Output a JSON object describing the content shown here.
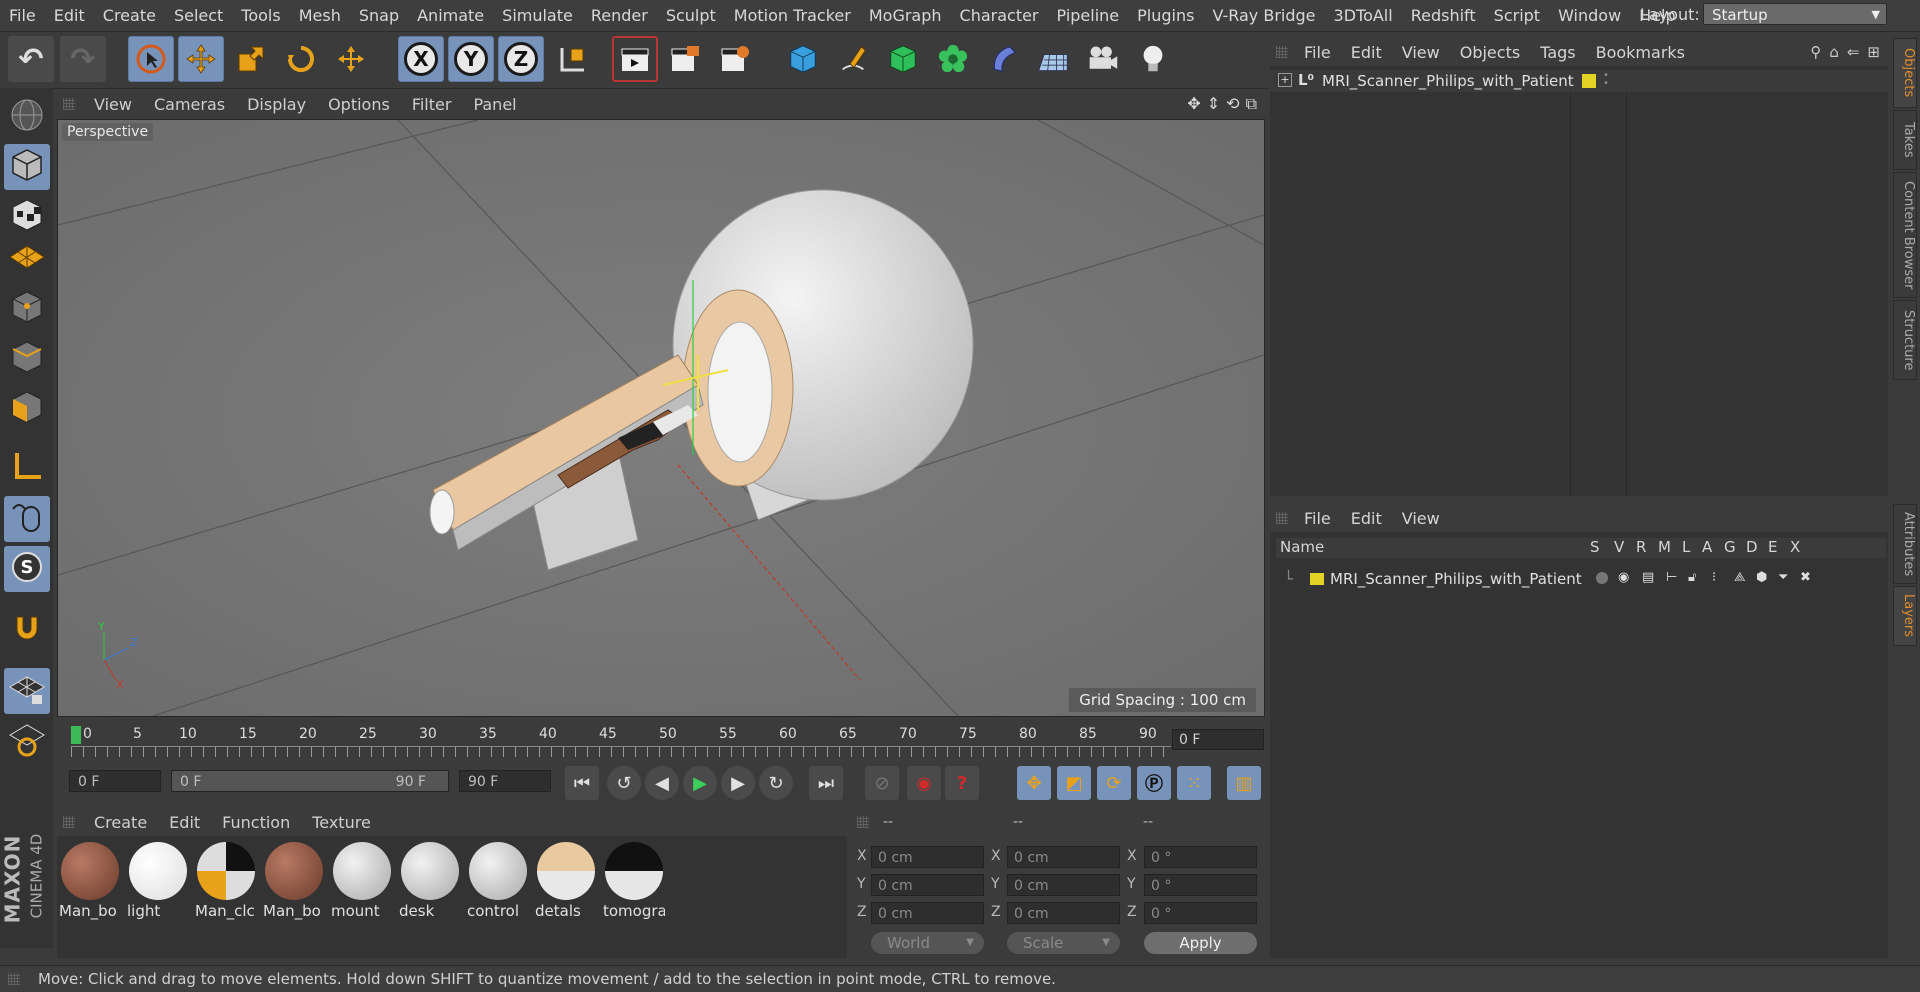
{
  "menubar": {
    "items": [
      "File",
      "Edit",
      "Create",
      "Select",
      "Tools",
      "Mesh",
      "Snap",
      "Animate",
      "Simulate",
      "Render",
      "Sculpt",
      "Motion Tracker",
      "MoGraph",
      "Character",
      "Pipeline",
      "Plugins",
      "V-Ray Bridge",
      "3DToAll",
      "Redshift",
      "Script",
      "Window",
      "Help"
    ],
    "layout_label": "Layout:",
    "layout_value": "Startup"
  },
  "toolbar": {
    "axis_x": "X",
    "axis_y": "Y",
    "axis_z": "Z"
  },
  "viewport": {
    "menu": [
      "View",
      "Cameras",
      "Display",
      "Options",
      "Filter",
      "Panel"
    ],
    "label": "Perspective",
    "grid_spacing": "Grid Spacing : 100 cm",
    "axis_x": "X",
    "axis_y": "Y",
    "axis_z": "Z"
  },
  "timeline": {
    "ticks": [
      "0",
      "5",
      "10",
      "15",
      "20",
      "25",
      "30",
      "35",
      "40",
      "45",
      "50",
      "55",
      "60",
      "65",
      "70",
      "75",
      "80",
      "85",
      "90"
    ],
    "current_frame": "0 F"
  },
  "transport": {
    "start_field": "0 F",
    "range_start": "0 F",
    "range_end": "90 F",
    "end_field": "90 F"
  },
  "materials": {
    "menu": [
      "Create",
      "Edit",
      "Function",
      "Texture"
    ],
    "items": [
      {
        "label": "Man_bo",
        "color": "#8a4a3a"
      },
      {
        "label": "light",
        "color": "#ffffff"
      },
      {
        "label": "Man_clc",
        "color": "#1c1c1c"
      },
      {
        "label": "Man_bo",
        "color": "#8a4a3a"
      },
      {
        "label": "mount",
        "color": "#d9d9d9"
      },
      {
        "label": "desk",
        "color": "#d9d9d9"
      },
      {
        "label": "control",
        "color": "#d9d9d9"
      },
      {
        "label": "detals",
        "color": "#e8c9a0"
      },
      {
        "label": "tomogra",
        "color": "#e6e6e6"
      }
    ]
  },
  "coords": {
    "headers": [
      "--",
      "--",
      "--"
    ],
    "rows": [
      {
        "axis": "X",
        "pos": "0 cm",
        "size": "0 cm",
        "rot": "0 °"
      },
      {
        "axis": "Y",
        "pos": "0 cm",
        "size": "0 cm",
        "rot": "0 °"
      },
      {
        "axis": "Z",
        "pos": "0 cm",
        "size": "0 cm",
        "rot": "0 °"
      }
    ],
    "size_labels": [
      "X",
      "Y",
      "Z"
    ],
    "rot_labels": [
      "X",
      "Y",
      "Z"
    ],
    "world": "World",
    "scale": "Scale",
    "apply": "Apply"
  },
  "objects": {
    "menu": [
      "File",
      "Edit",
      "View",
      "Objects",
      "Tags",
      "Bookmarks"
    ],
    "item": "MRI_Scanner_Philips_with_Patient",
    "layer_color": "#e2d224"
  },
  "layers": {
    "menu": [
      "File",
      "Edit",
      "View"
    ],
    "columns": [
      "Name",
      "S",
      "V",
      "R",
      "M",
      "L",
      "A",
      "G",
      "D",
      "E",
      "X"
    ],
    "item": "MRI_Scanner_Philips_with_Patient"
  },
  "side_tabs": [
    "Objects",
    "Takes",
    "Content Browser",
    "Structure",
    "Attributes",
    "Layers"
  ],
  "brand": {
    "line1": "MAXON",
    "line2": "CINEMA 4D"
  },
  "status": "Move: Click and drag to move elements. Hold down SHIFT to quantize movement / add to the selection in point mode, CTRL to remove."
}
